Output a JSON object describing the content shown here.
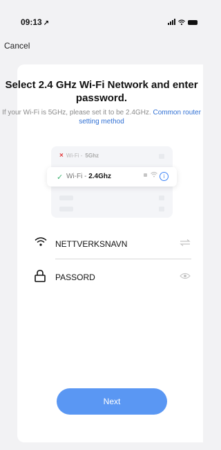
{
  "status_bar": {
    "time": "09:13",
    "location_arrow": "↗"
  },
  "nav": {
    "cancel_label": "Cancel"
  },
  "header": {
    "title": "Select 2.4 GHz Wi-Fi Network and enter password.",
    "hint": "If your Wi-Fi is 5GHz, please set it to be 2.4GHz.",
    "link": "Common router setting method"
  },
  "diagram": {
    "band5_prefix": "Wi-Fi - ",
    "band5_value": "5Ghz",
    "band24_prefix": "Wi-Fi - ",
    "band24_value": "2.4Ghz",
    "info_glyph": "i",
    "x_glyph": "×",
    "check_glyph": "✓"
  },
  "form": {
    "network_name": "NETTVERKSNAVN",
    "password": "PASSORD"
  },
  "actions": {
    "next_label": "Next"
  },
  "icons": {
    "wifi": "wifi-icon",
    "lock": "lock-icon",
    "swap": "swap-icon",
    "eye": "eye-icon",
    "info": "info-icon"
  },
  "colors": {
    "accent": "#5a97f3",
    "link": "#2f6fd3",
    "success": "#3cb371",
    "error": "#e23b3b"
  }
}
